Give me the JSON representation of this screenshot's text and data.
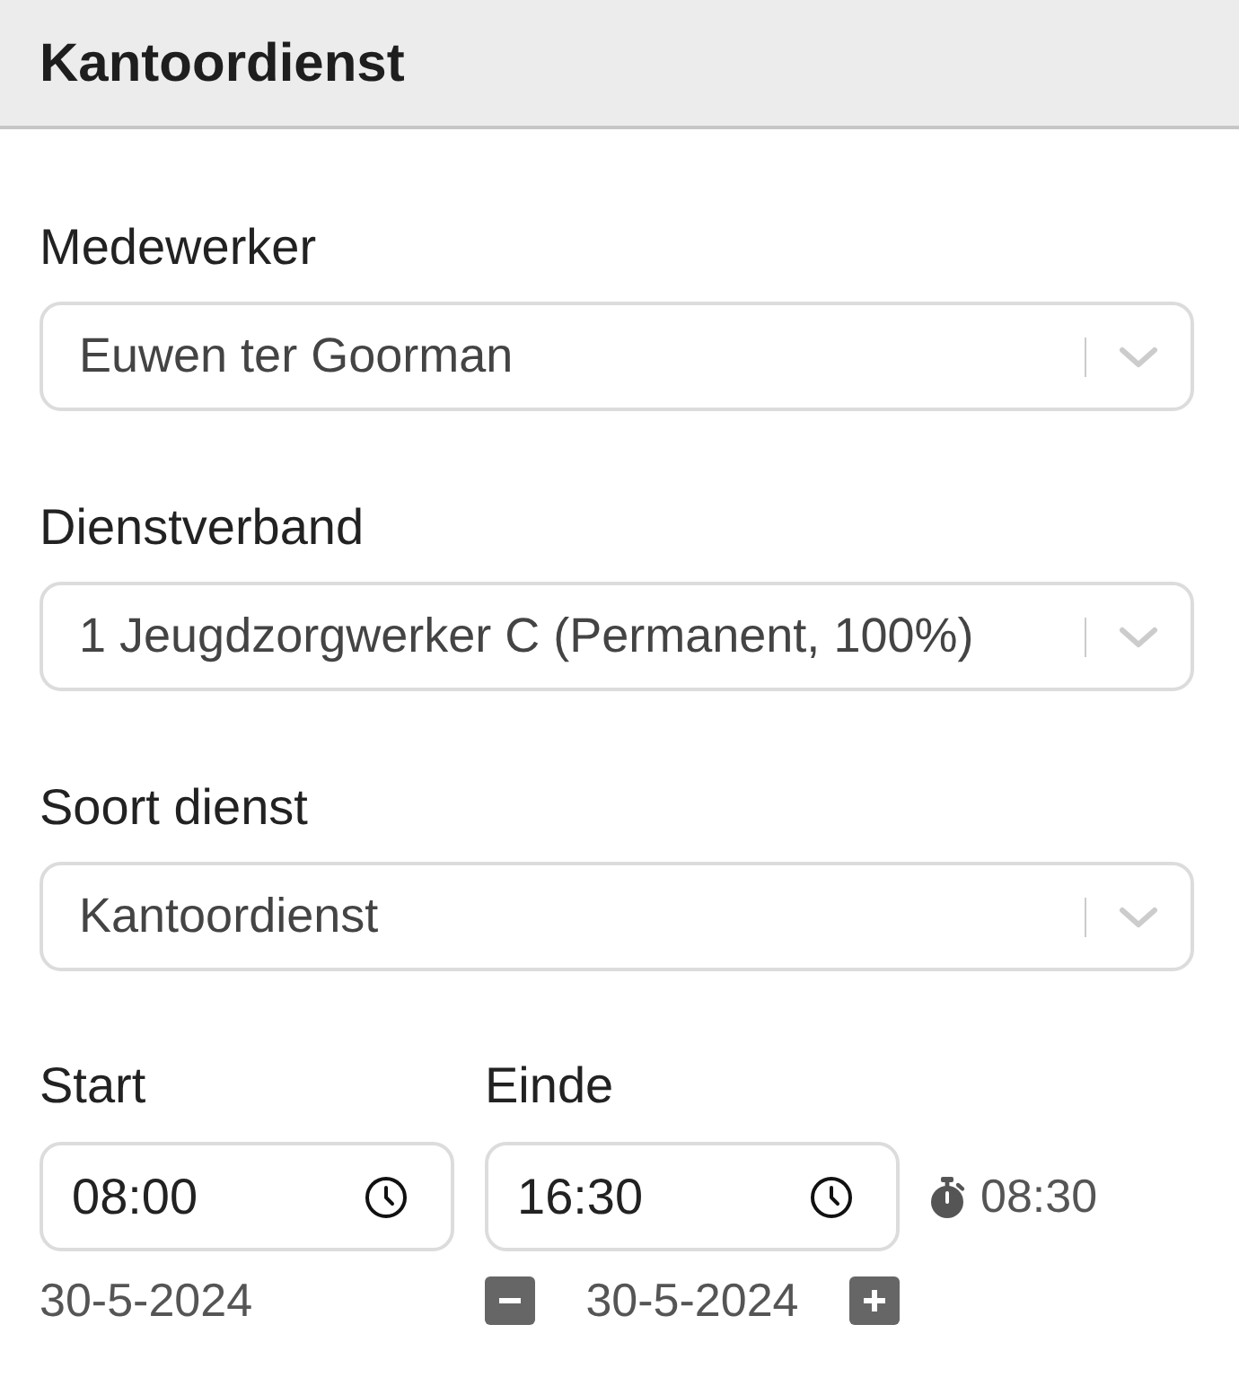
{
  "header": {
    "title": "Kantoordienst"
  },
  "fields": [
    {
      "label": "Medewerker",
      "value": "Euwen ter Goorman"
    },
    {
      "label": "Dienstverband",
      "value": "1 Jeugdzorgwerker C (Permanent, 100%)"
    },
    {
      "label": "Soort dienst",
      "value": "Kantoordienst"
    }
  ],
  "times": [
    {
      "kind": "start",
      "label": "Start",
      "value": "08:00",
      "date": "30-5-2024"
    },
    {
      "kind": "end",
      "label": "Einde",
      "value": "16:30",
      "date": "30-5-2024"
    }
  ],
  "duration": "08:30"
}
